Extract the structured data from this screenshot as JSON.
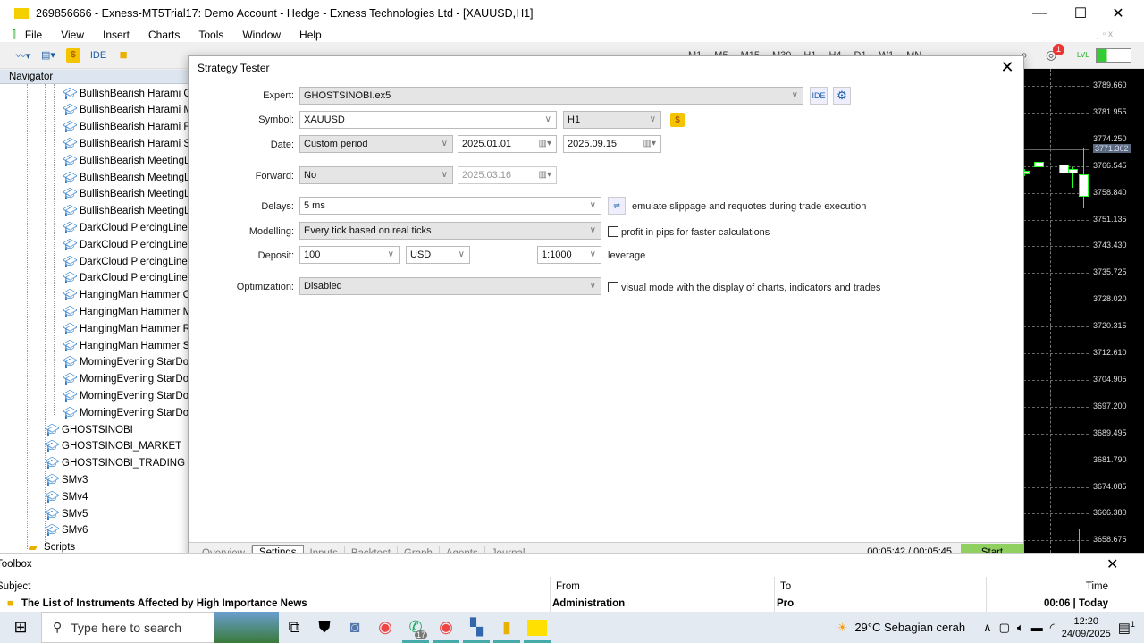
{
  "window": {
    "title": "269856666 - Exness-MT5Trial17: Demo Account - Hedge - Exness Technologies Ltd - [XAUUSD,H1]",
    "minimize": "—",
    "maximize": "☐",
    "close": "✕"
  },
  "menu": [
    "File",
    "View",
    "Insert",
    "Charts",
    "Tools",
    "Window",
    "Help"
  ],
  "toolbar": {
    "ide": "IDE",
    "dollar": "$",
    "timeframes": [
      "M1",
      "M5",
      "M15",
      "M30",
      "H1",
      "H4",
      "D1",
      "W1",
      "MN"
    ],
    "notification_count": "1",
    "lvl": "LVL"
  },
  "navigator": {
    "title": "Navigator",
    "experts": [
      "BullishBearish Harami C",
      "BullishBearish Harami M",
      "BullishBearish Harami RS",
      "BullishBearish Harami St",
      "BullishBearish MeetingL",
      "BullishBearish MeetingL",
      "BullishBearish MeetingL",
      "BullishBearish MeetingL",
      "DarkCloud PiercingLine",
      "DarkCloud PiercingLine",
      "DarkCloud PiercingLine",
      "DarkCloud PiercingLine",
      "HangingMan Hammer C",
      "HangingMan Hammer M",
      "HangingMan Hammer R",
      "HangingMan Hammer S",
      "MorningEvening StarDo",
      "MorningEvening StarDo",
      "MorningEvening StarDo",
      "MorningEvening StarDo"
    ],
    "top_experts": [
      "GHOSTSINOBI",
      "GHOSTSINOBI_MARKET",
      "GHOSTSINOBI_TRADING",
      "SMv3",
      "SMv4",
      "SMv5",
      "SMv6"
    ],
    "scripts": "Scripts"
  },
  "chart": {
    "prices": [
      "3789.660",
      "3781.955",
      "3774.250",
      "3766.545",
      "3758.840",
      "3751.135",
      "3743.430",
      "3735.725",
      "3728.020",
      "3720.315",
      "3712.610",
      "3704.905",
      "3697.200",
      "3689.495",
      "3681.790",
      "3674.085",
      "3666.380",
      "3658.675"
    ],
    "current_price": "3771.362",
    "background": "#000000",
    "candle_color": "#22ff22"
  },
  "tester": {
    "title": "Strategy Tester",
    "close": "✕",
    "expert_label": "Expert:",
    "expert": "GHOSTSINOBI.ex5",
    "ide": "IDE",
    "symbol_label": "Symbol:",
    "symbol": "XAUUSD",
    "timeframe": "H1",
    "date_label": "Date:",
    "date_mode": "Custom period",
    "date_from": "2025.01.01",
    "date_to": "2025.09.15",
    "forward_label": "Forward:",
    "forward": "No",
    "forward_date": "2025.03.16",
    "delays_label": "Delays:",
    "delays": "5 ms",
    "delays_note": "emulate slippage and requotes during trade execution",
    "modelling_label": "Modelling:",
    "modelling": "Every tick based on real ticks",
    "pips_note": "profit in pips for faster calculations",
    "deposit_label": "Deposit:",
    "deposit": "100",
    "currency": "USD",
    "leverage": "1:1000",
    "leverage_note": "leverage",
    "optimization_label": "Optimization:",
    "optimization": "Disabled",
    "visual_note": "visual mode with the display of charts, indicators and trades",
    "tabs": [
      "Overview",
      "Settings",
      "Inputs",
      "Backtest",
      "Graph",
      "Agents",
      "Journal"
    ],
    "active_tab": "Settings",
    "timer": "00:05:42 / 00:05:45",
    "start": "Start",
    "start_color": "#8fd060"
  },
  "toolbox": {
    "title": "Toolbox",
    "close": "✕",
    "columns": [
      "Subject",
      "From",
      "To",
      "Time"
    ],
    "rows": [
      {
        "subject": "The List of Instruments Affected by High Importance News",
        "from": "Administration",
        "to": "Pro",
        "time": "00:06 | Today"
      }
    ]
  },
  "taskbar": {
    "search_placeholder": "Type here to search",
    "whatsapp_badge": "17",
    "weather": "29°C  Sebagian cerah",
    "time": "12:20",
    "date": "24/09/2025",
    "notif": "1"
  }
}
